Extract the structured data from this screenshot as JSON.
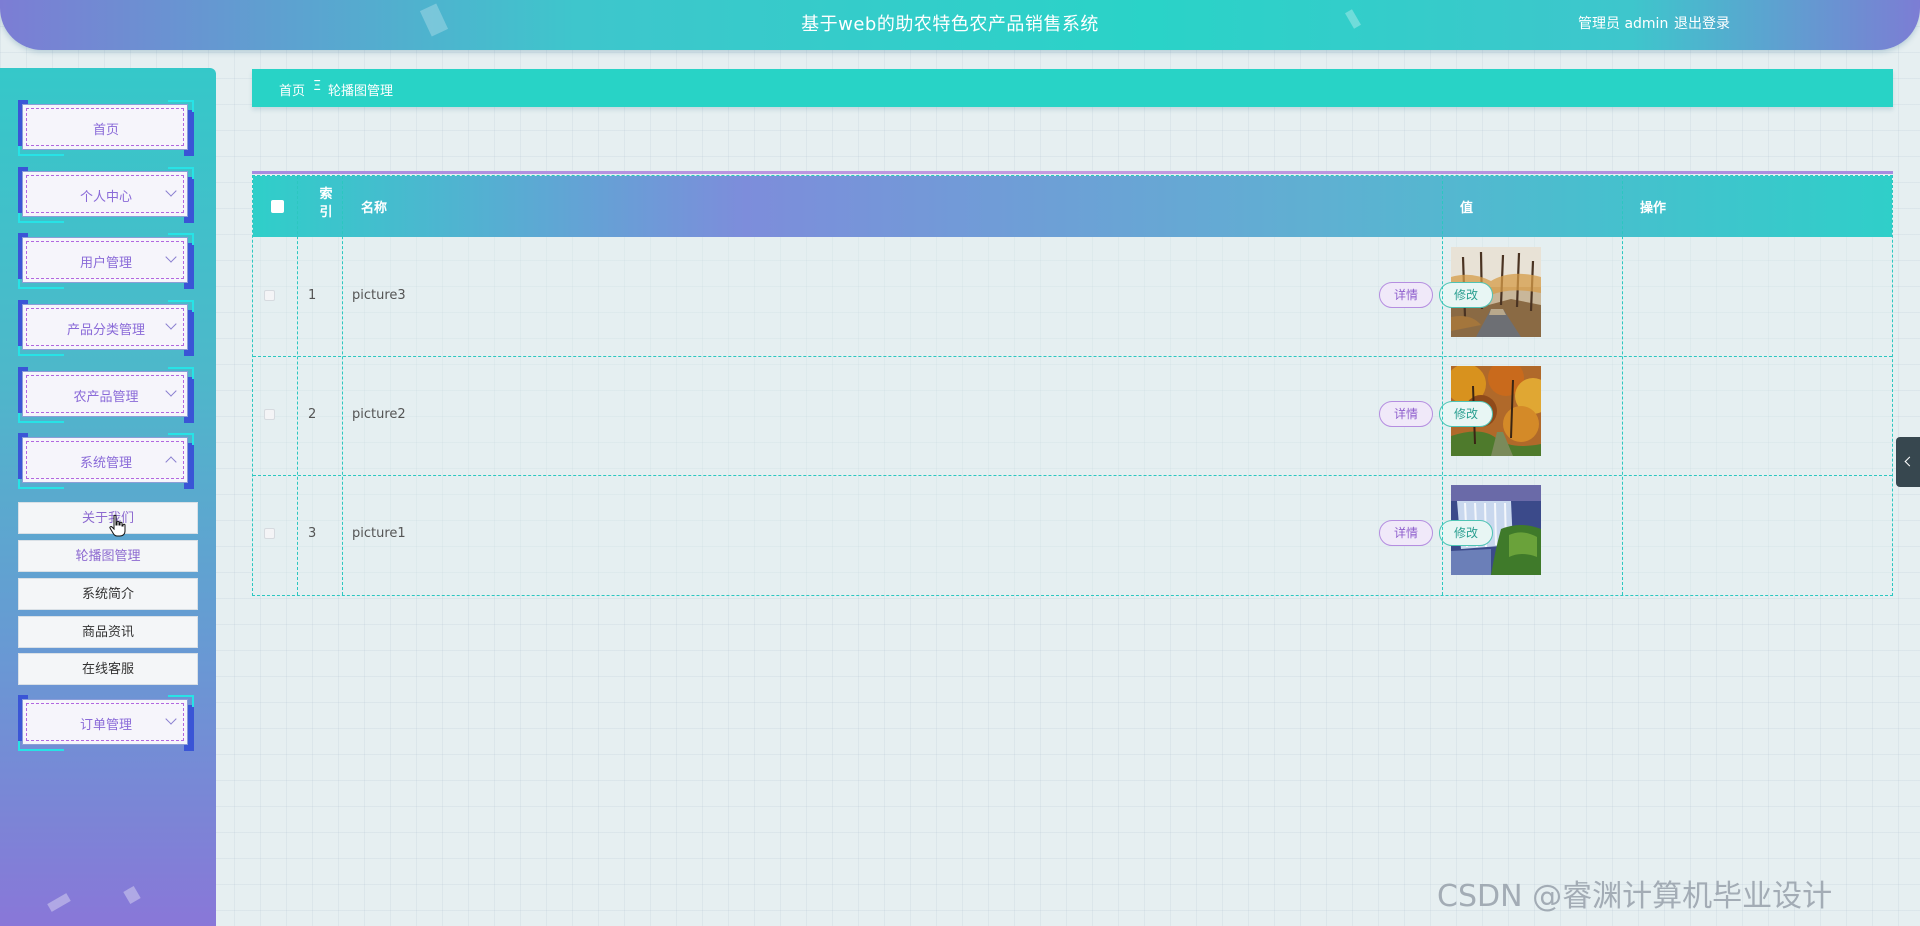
{
  "header": {
    "title": "基于web的助农特色农产品销售系统",
    "user": "管理员 admin",
    "logout": "退出登录"
  },
  "sidebar": {
    "menu": [
      {
        "label": "首页"
      },
      {
        "label": "个人中心"
      },
      {
        "label": "用户管理"
      },
      {
        "label": "产品分类管理"
      },
      {
        "label": "农产品管理"
      },
      {
        "label": "系统管理"
      },
      {
        "label": "订单管理"
      }
    ],
    "submenu": [
      "关于我们",
      "轮播图管理",
      "系统简介",
      "商品资讯",
      "在线客服"
    ]
  },
  "breadcrumb": {
    "home": "首页",
    "separator": "Ξ",
    "current": "轮播图管理"
  },
  "table": {
    "columns": {
      "index": "索引",
      "name": "名称",
      "value": "值",
      "action": "操作"
    },
    "rows": [
      {
        "index": "1",
        "name": "picture3",
        "image": "winter-forest-road"
      },
      {
        "index": "2",
        "name": "picture2",
        "image": "autumn-forest-path"
      },
      {
        "index": "3",
        "name": "picture1",
        "image": "waterfall"
      }
    ],
    "detail_label": "详情",
    "edit_label": "修改"
  },
  "watermark": "CSDN @睿渊计算机毕业设计",
  "colors": {
    "accent_teal": "#28d3c6",
    "accent_purple": "#8a6ad8",
    "menu_corner_blue": "#3a55d6"
  }
}
